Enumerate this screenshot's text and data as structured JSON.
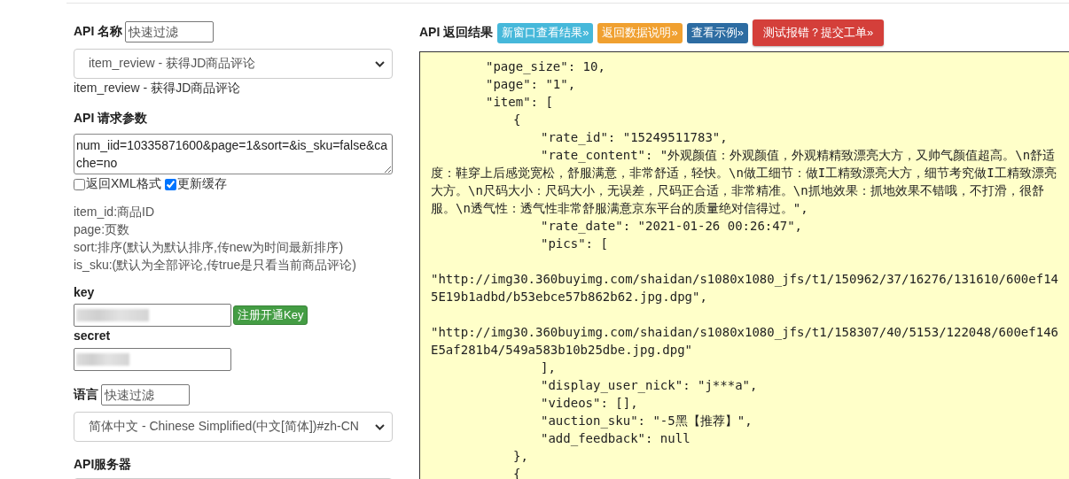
{
  "api_name": {
    "label": "API 名称",
    "filter_placeholder": "快速过滤",
    "selected": "item_review - 获得JD商品评论",
    "description": "item_review - 获得JD商品评论"
  },
  "params": {
    "label": "API 请求参数",
    "value": "num_iid=10335871600&page=1&sort=&is_sku=false&cache=no",
    "options": [
      {
        "label": "返回XML格式",
        "checked": false
      },
      {
        "label": "更新缓存",
        "checked": true
      }
    ],
    "help": [
      "item_id:商品ID",
      "page:页数",
      "sort:排序(默认为默认排序,传new为时间最新排序)",
      "is_sku:(默认为全部评论,传true是只看当前商品评论)"
    ]
  },
  "key": {
    "label": "key",
    "button": "注册开通Key"
  },
  "secret": {
    "label": "secret"
  },
  "language": {
    "label": "语言",
    "filter_placeholder": "快速过滤",
    "selected": "简体中文 - Chinese Simplified(中文[简体])#zh-CN"
  },
  "server": {
    "label": "API服务器"
  },
  "result": {
    "label": "API 返回结果",
    "buttons": [
      {
        "label": "新窗口查看结果»",
        "kind": "info"
      },
      {
        "label": "返回数据说明»",
        "kind": "warning"
      },
      {
        "label": "查看示例»",
        "kind": "primary"
      },
      {
        "label": "测试报错？提交工单»",
        "kind": "danger"
      }
    ],
    "text": "\t\t\"page_size\": 10,\n\t\t\"page\": \"1\",\n\t\t\"item\": [\n\t\t\t{\n\t\t\t\t\"rate_id\": \"15249511783\",\n\t\t\t\t\"rate_content\": \"外观颜值：外观颜值，外观精精致漂亮大方，又帅气颜值超高。\\n舒适度：鞋穿上后感觉宽松，舒服满意，非常舒适，轻快。\\n做工细节：做I工精致漂亮大方，细节考究做I工精致漂亮大方。\\n尺码大小：尺码大小，无误差，尺码正合适，非常精准。\\n抓地效果：抓地效果不错哦，不打滑，很舒服。\\n透气性：透气性非常舒服满意京东平台的质量绝对信得过。\",\n\t\t\t\t\"rate_date\": \"2021-01-26 00:26:47\",\n\t\t\t\t\"pics\": [\n\n\"http://img30.360buyimg.com/shaidan/s1080x1080_jfs/t1/150962/37/16276/131610/600ef145E19b1adbd/b53ebce57b862b62.jpg.dpg\",\n\n\"http://img30.360buyimg.com/shaidan/s1080x1080_jfs/t1/158307/40/5153/122048/600ef146E5af281b4/549a583b10b25dbe.jpg.dpg\"\n\t\t\t\t],\n\t\t\t\t\"display_user_nick\": \"j***a\",\n\t\t\t\t\"videos\": [],\n\t\t\t\t\"auction_sku\": \"-5黑【推荐】\",\n\t\t\t\t\"add_feedback\": null\n\t\t\t},\n\t\t\t{"
  }
}
